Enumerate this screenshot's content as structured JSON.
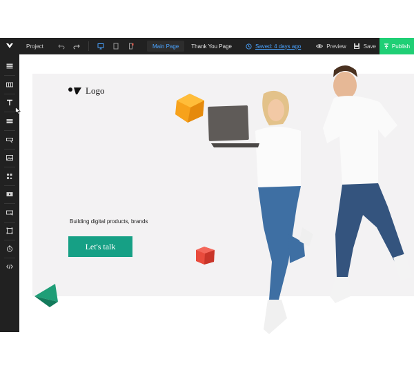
{
  "toolbar": {
    "project_label": "Project",
    "tabs": [
      {
        "label": "Main Page",
        "active": true
      },
      {
        "label": "Thank You Page",
        "active": false
      }
    ],
    "saved_label": "Saved: 4 days ago",
    "preview_label": "Preview",
    "save_label": "Save",
    "publish_label": "Publish"
  },
  "sidebar": {
    "items": [
      {
        "icon": "section-icon"
      },
      {
        "icon": "row-icon"
      },
      {
        "icon": "text-icon"
      },
      {
        "icon": "divider-icon"
      },
      {
        "icon": "button-icon"
      },
      {
        "icon": "image-icon"
      },
      {
        "icon": "shapes-icon"
      },
      {
        "icon": "video-icon"
      },
      {
        "icon": "form-icon"
      },
      {
        "icon": "box-icon"
      },
      {
        "icon": "timer-icon"
      },
      {
        "icon": "code-icon"
      }
    ]
  },
  "page": {
    "logo_text": "Logo",
    "tagline": "Building digital products, brands",
    "cta_label": "Let's talk"
  },
  "colors": {
    "toolbar_bg": "#212121",
    "accent_blue": "#4aa3ff",
    "publish_green": "#1fcf75",
    "cta_green": "#16a085",
    "canvas_bg": "#f3f2f3"
  }
}
